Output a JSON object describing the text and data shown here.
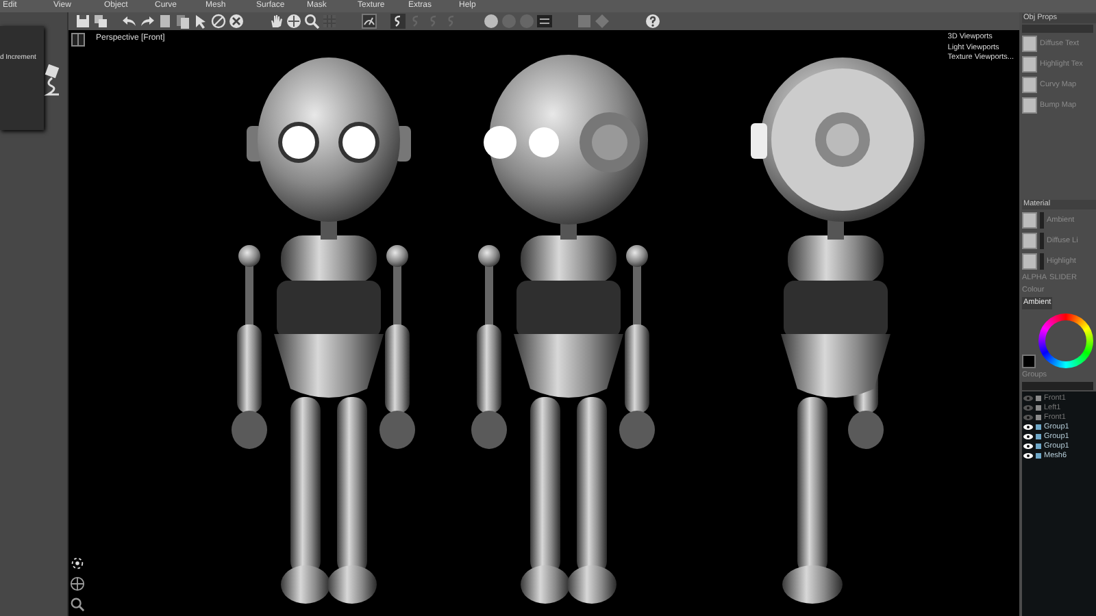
{
  "menu": [
    "Edit",
    "View",
    "Object",
    "Curve",
    "Mesh",
    "Surface",
    "Mask",
    "Texture",
    "Extras",
    "Help"
  ],
  "left_panel": {
    "text": "d Increment"
  },
  "viewport": {
    "label": "Perspective [Front]",
    "links": [
      "3D Viewports",
      "Light Viewports",
      "Texture Viewports..."
    ]
  },
  "obj_props": {
    "title": "Obj Props",
    "textures": [
      "Diffuse Text",
      "Highlight Tex",
      "Curvy Map",
      "Bump Map"
    ]
  },
  "material": {
    "title": "Material",
    "rows": [
      "Ambient",
      "Diffuse Li",
      "Highlight"
    ],
    "sliders": [
      "ALPHA",
      "SLIDER"
    ]
  },
  "colour": {
    "title": "Colour",
    "channel": "Ambient"
  },
  "groups": {
    "title": "Groups",
    "items": [
      {
        "name": "Front1",
        "visible": false,
        "color": "#8a8a8a"
      },
      {
        "name": "Left1",
        "visible": false,
        "color": "#8a8a8a"
      },
      {
        "name": "Front1",
        "visible": false,
        "color": "#8a8a8a"
      },
      {
        "name": "Group1",
        "visible": true,
        "color": "#6fa8c8"
      },
      {
        "name": "Group1",
        "visible": true,
        "color": "#6fa8c8"
      },
      {
        "name": "Group1",
        "visible": true,
        "color": "#6fa8c8"
      },
      {
        "name": "Mesh6",
        "visible": true,
        "color": "#6fa8c8"
      }
    ]
  }
}
